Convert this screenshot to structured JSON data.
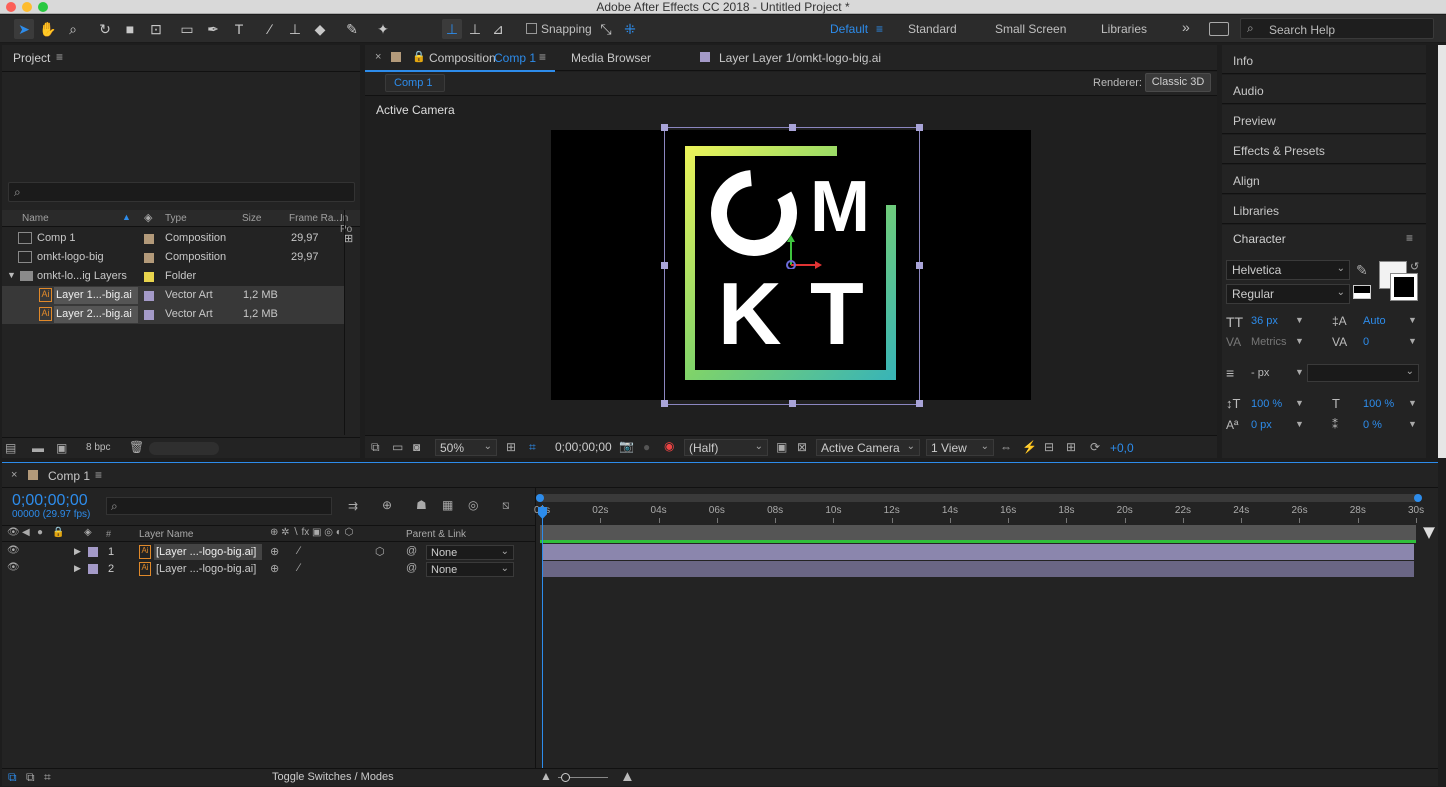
{
  "app_title": "Adobe After Effects CC 2018 - Untitled Project *",
  "workspaces": {
    "default": "Default",
    "standard": "Standard",
    "small_screen": "Small Screen",
    "libraries": "Libraries",
    "search_placeholder": "Search Help",
    "snapping": "Snapping"
  },
  "project": {
    "title": "Project",
    "columns": [
      "Name",
      "Type",
      "Size",
      "Frame Ra...",
      "In Po"
    ],
    "rows": [
      {
        "name": "Comp 1",
        "type": "Composition",
        "size": "",
        "fps": "29,97",
        "color": "#b39a7a"
      },
      {
        "name": "omkt-logo-big",
        "type": "Composition",
        "size": "",
        "fps": "29,97",
        "color": "#b39a7a"
      },
      {
        "name": "omkt-lo...ig Layers",
        "type": "Folder",
        "size": "",
        "fps": "",
        "color": "#e8d44d"
      },
      {
        "name": "Layer 1...-big.ai",
        "type": "Vector Art",
        "size": "1,2 MB",
        "fps": "",
        "color": "#a49ac8"
      },
      {
        "name": "Layer 2...-big.ai",
        "type": "Vector Art",
        "size": "1,2 MB",
        "fps": "",
        "color": "#a49ac8"
      }
    ],
    "bpc": "8 bpc"
  },
  "viewer": {
    "tab_composition_prefix": "Composition",
    "tab_composition_name": "Comp 1",
    "tab_media": "Media Browser",
    "tab_layer": "Layer Layer 1/omkt-logo-big.ai",
    "subtab": "Comp 1",
    "renderer_label": "Renderer:",
    "renderer_value": "Classic 3D",
    "camera_label": "Active Camera",
    "logo_letters": [
      "M",
      "K",
      "T"
    ],
    "zoom": "50%",
    "timecode": "0;00;00;00",
    "resolution": "(Half)",
    "view_camera": "Active Camera",
    "views": "1 View",
    "exposure": "+0,0"
  },
  "right_panels": [
    "Info",
    "Audio",
    "Preview",
    "Effects & Presets",
    "Align",
    "Libraries"
  ],
  "character": {
    "title": "Character",
    "font": "Helvetica",
    "style": "Regular",
    "size": "36 px",
    "leading": "Auto",
    "kerning": "Metrics",
    "tracking": "0",
    "stroke": "- px",
    "vscale": "100 %",
    "hscale": "100 %",
    "baseline": "0 px",
    "tsume": "0 %"
  },
  "timeline": {
    "tab": "Comp 1",
    "timecode": "0;00;00;00",
    "frames": "00000 (29.97 fps)",
    "col_layer_name": "Layer Name",
    "col_parent": "Parent & Link",
    "col_num": "#",
    "layers": [
      {
        "num": "1",
        "name": "[Layer ...-logo-big.ai]",
        "parent": "None"
      },
      {
        "num": "2",
        "name": "[Layer ...-logo-big.ai]",
        "parent": "None"
      }
    ],
    "ruler": [
      "00s",
      "02s",
      "04s",
      "06s",
      "08s",
      "10s",
      "12s",
      "14s",
      "16s",
      "18s",
      "20s",
      "22s",
      "24s",
      "26s",
      "28s",
      "30s"
    ],
    "toggle": "Toggle Switches / Modes"
  }
}
